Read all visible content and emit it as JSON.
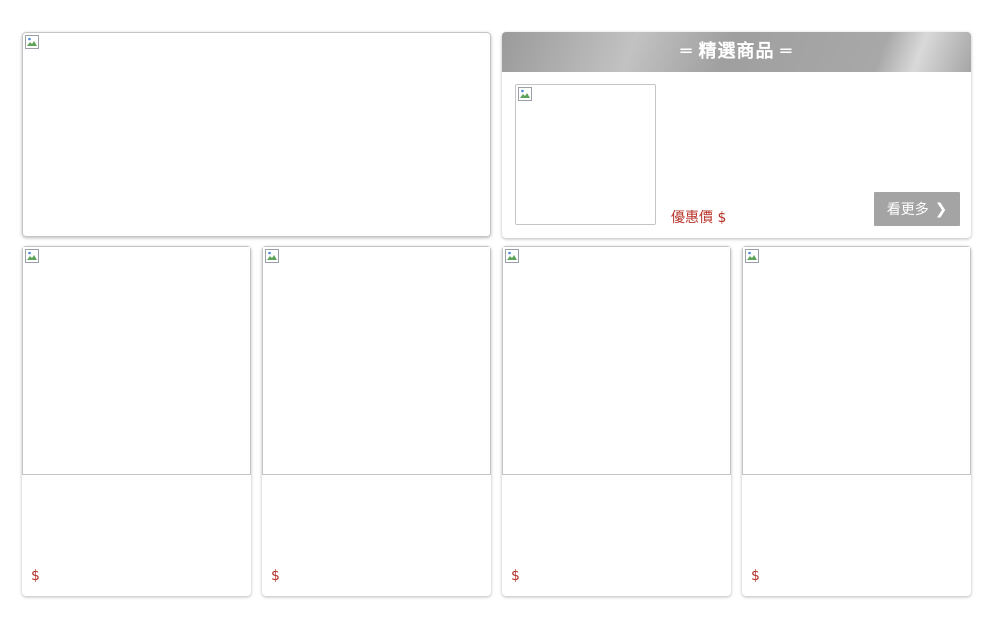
{
  "featured": {
    "title": "精選商品",
    "title_dash": "═",
    "promo_price_label": "優惠價 $",
    "more_label": "看更多",
    "more_icon": "chevron-right-icon"
  },
  "products": [
    {
      "price": "$"
    },
    {
      "price": "$"
    },
    {
      "price": "$"
    },
    {
      "price": "$"
    }
  ],
  "colors": {
    "price": "#b8342a",
    "button": "#a4a4a4",
    "header_gray": "#a0a0a0"
  }
}
